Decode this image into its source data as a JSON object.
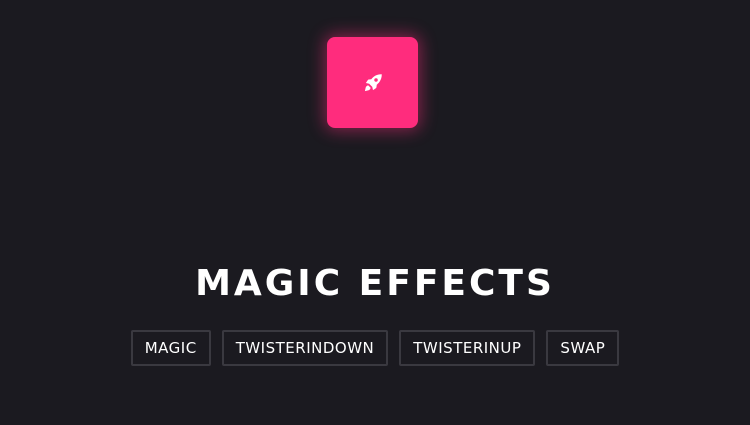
{
  "colors": {
    "background": "#1b1a20",
    "accent": "#ff2c7d",
    "text": "#ffffff",
    "button_border": "#3a3940"
  },
  "box": {
    "icon": "rocket-icon"
  },
  "title": "MAGIC EFFECTS",
  "buttons": [
    {
      "label": "MAGIC"
    },
    {
      "label": "TWISTERINDOWN"
    },
    {
      "label": "TWISTERINUP"
    },
    {
      "label": "SWAP"
    }
  ]
}
